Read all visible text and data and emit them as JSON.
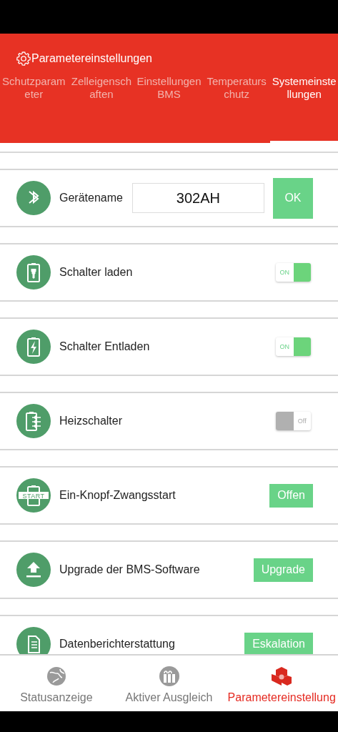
{
  "header": {
    "title": "Parametereinstellungen"
  },
  "tabs": [
    {
      "label": "Schutzparameter",
      "selected": false
    },
    {
      "label": "Zelleigenschaften",
      "selected": false
    },
    {
      "label": "Einstellungen BMS",
      "selected": false
    },
    {
      "label": "Temperaturschutz",
      "selected": false
    },
    {
      "label": "Systemeinstellungen",
      "selected": true
    }
  ],
  "rows": [
    {
      "kind": "field",
      "label": "Gerätename",
      "value": "302AH",
      "button": "OK"
    },
    {
      "kind": "toggle",
      "label": "Schalter laden",
      "on": true,
      "toggle_text": "ON"
    },
    {
      "kind": "toggle",
      "label": "Schalter Entladen",
      "on": true,
      "toggle_text": "ON"
    },
    {
      "kind": "toggle",
      "label": "Heizschalter",
      "on": false,
      "toggle_text": "Off"
    },
    {
      "kind": "button",
      "label": "Ein-Knopf-Zwangsstart",
      "button": "Offen",
      "icon_text": "START"
    },
    {
      "kind": "button",
      "label": "Upgrade der BMS-Software",
      "button": "Upgrade"
    },
    {
      "kind": "button",
      "label": "Datenberichterstattung",
      "button": "Eskalation"
    }
  ],
  "bottom_nav": [
    {
      "label": "Statusanzeige",
      "selected": false
    },
    {
      "label": "Aktiver Ausgleich",
      "selected": false
    },
    {
      "label": "Parametereinstellung",
      "selected": true
    }
  ]
}
